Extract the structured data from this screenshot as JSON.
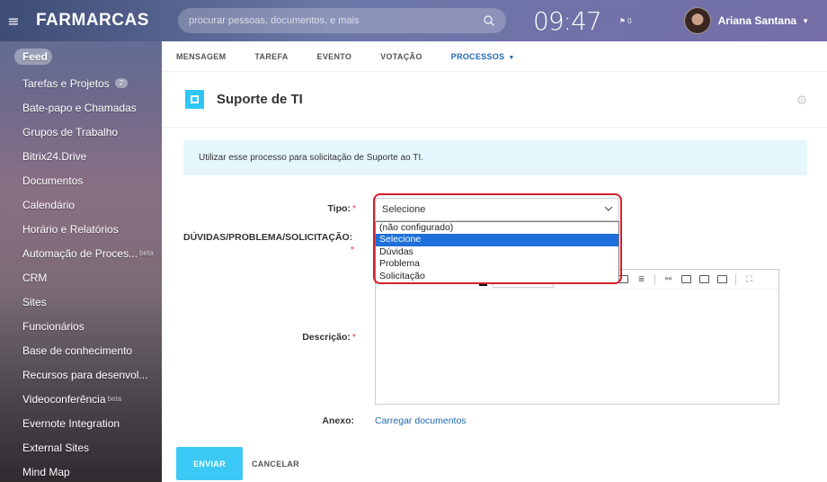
{
  "header": {
    "logo": "FARMARCAS",
    "search_placeholder": "procurar pessoas, documentos, e mais",
    "clock": "09:47",
    "flag_count": "⚑ 0",
    "user_name": "Ariana Santana"
  },
  "sidebar": {
    "items": [
      {
        "label": "Feed"
      },
      {
        "label": "Tarefas e Projetos",
        "badge": "2"
      },
      {
        "label": "Bate-papo e Chamadas"
      },
      {
        "label": "Grupos de Trabalho"
      },
      {
        "label": "Bitrix24.Drive"
      },
      {
        "label": "Documentos"
      },
      {
        "label": "Calendário"
      },
      {
        "label": "Horário e Relatórios"
      },
      {
        "label": "Automação de Proces...",
        "sup": "beta"
      },
      {
        "label": "CRM"
      },
      {
        "label": "Sites"
      },
      {
        "label": "Funcionários"
      },
      {
        "label": "Base de conhecimento"
      },
      {
        "label": "Recursos para desenvol..."
      },
      {
        "label": "Videoconferência",
        "sup": "beta"
      },
      {
        "label": "Evernote Integration"
      },
      {
        "label": "External Sites"
      },
      {
        "label": "Mind Map"
      }
    ]
  },
  "tabs": [
    {
      "label": "MENSAGEM"
    },
    {
      "label": "TAREFA"
    },
    {
      "label": "EVENTO"
    },
    {
      "label": "VOTAÇÃO"
    },
    {
      "label": "PROCESSOS"
    }
  ],
  "process": {
    "title": "Suporte de TI",
    "info": "Utilizar esse processo para solicitação de Suporte ao TI."
  },
  "form": {
    "tipo_label": "Tipo:",
    "duvidas_label": "DÚVIDAS/PROBLEMA/SOLICITAÇÃO:",
    "descricao_label": "Descrição:",
    "anexo_label": "Anexo:",
    "required_mark": "*",
    "select_value": "Selecione",
    "options": [
      "(não configurado)",
      "Selecione",
      "Dúvidas",
      "Problema",
      "Solicitação"
    ],
    "selected_index": 1,
    "upload_link": "Carregar documentos"
  },
  "buttons": {
    "send": "ENVIAR",
    "cancel": "CANCELAR"
  },
  "colors": {
    "accent": "#3bc8f5",
    "active_tab": "#2067b0",
    "highlight_border": "#d81e2b",
    "selected_option": "#1e6fd9"
  }
}
